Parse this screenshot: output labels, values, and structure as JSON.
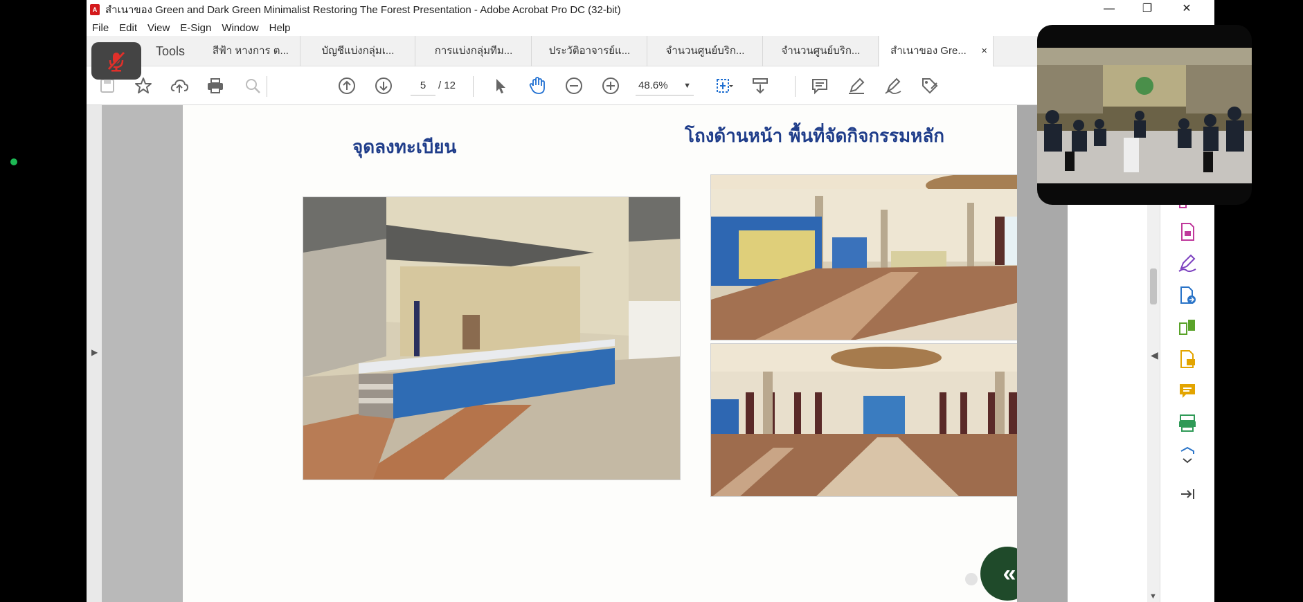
{
  "window": {
    "title": "สำเนาของ Green and Dark Green Minimalist Restoring The Forest Presentation - Adobe Acrobat Pro DC (32-bit)",
    "app_icon": "pdf-icon",
    "controls": {
      "minimize": "—",
      "maximize": "❐",
      "close": "✕"
    }
  },
  "menu": [
    "File",
    "Edit",
    "View",
    "E-Sign",
    "Window",
    "Help"
  ],
  "tabs": {
    "tools": "Tools",
    "docs": [
      "สีฟ้า หางการ ต...",
      "บัญชีแบ่งกลุ่มเ...",
      "การแบ่งกลุ่มทีม...",
      "ประวัติอาจารย์แ...",
      "จำนวนศูนย์บริก...",
      "จำนวนศูนย์บริก...",
      "สำเนาของ Gre..."
    ],
    "active_index": 6,
    "close_symbol": "×"
  },
  "meeting": {
    "mic_state": "muted",
    "mic_icon": "mic-off-icon"
  },
  "toolbar": {
    "page_current": "5",
    "page_total": "/ 12",
    "zoom": "48.6%",
    "zoom_caret": "▼"
  },
  "slide": {
    "left_heading": "จุดลงทะเบียน",
    "right_heading": "โถงด้านหน้า พื้นที่จัดกิจกรรมหลัก",
    "nav_button": "«"
  },
  "colors": {
    "heading": "#1f3d8a",
    "nav_circle": "#1f4a2a",
    "mic_bg": "#444444",
    "mic_slash": "#e0302a"
  }
}
